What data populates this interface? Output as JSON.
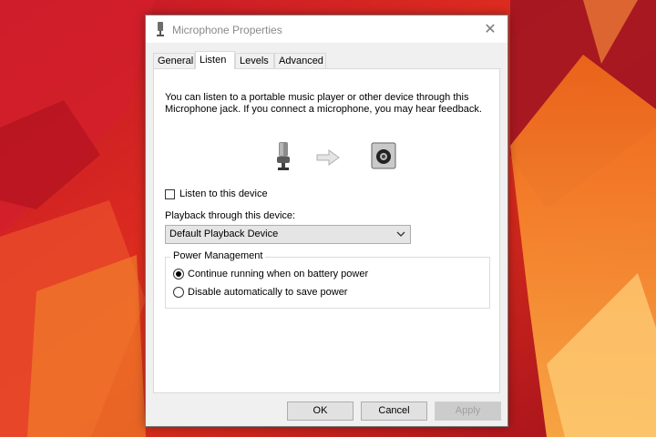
{
  "window": {
    "title": "Microphone Properties",
    "close_glyph": "✕"
  },
  "tabs": [
    {
      "label": "General",
      "active": false
    },
    {
      "label": "Listen",
      "active": true
    },
    {
      "label": "Levels",
      "active": false
    },
    {
      "label": "Advanced",
      "active": false
    }
  ],
  "listen": {
    "description": "You can listen to a portable music player or other device through this Microphone jack.  If you connect a microphone, you may hear feedback.",
    "listen_checkbox_label": "Listen to this device",
    "listen_checked": false,
    "playback_label": "Playback through this device:",
    "playback_selected": "Default Playback Device"
  },
  "power": {
    "group_title": "Power Management",
    "options": [
      {
        "label": "Continue running when on battery power",
        "checked": true
      },
      {
        "label": "Disable automatically to save power",
        "checked": false
      }
    ]
  },
  "buttons": {
    "ok": "OK",
    "cancel": "Cancel",
    "apply": "Apply"
  },
  "icons": [
    "microphone-icon",
    "arrow-right-icon",
    "speaker-icon",
    "chevron-down-icon",
    "close-icon"
  ]
}
